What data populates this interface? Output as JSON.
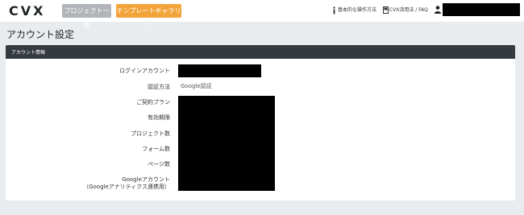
{
  "header": {
    "logo_text": "CVX",
    "project_list_button": "プロジェクト一覧",
    "template_gallery_button": "テンプレートギャラリー",
    "guide_link": "基本的な操作方法",
    "faq_link": "CVX活用法 / FAQ",
    "user_name": ""
  },
  "page": {
    "title": "アカウント設定"
  },
  "panel": {
    "header": "アカウント情報",
    "rows": [
      {
        "label": "ログインアカウント",
        "value": ""
      },
      {
        "label": "認証方法",
        "value": "Google認証"
      },
      {
        "label": "ご契約プラン",
        "value": ""
      },
      {
        "label": "有効期限",
        "value": ""
      },
      {
        "label": "プロジェクト数",
        "value": ""
      },
      {
        "label": "フォーム数",
        "value": ""
      },
      {
        "label": "ページ数",
        "value": ""
      },
      {
        "label": "Googleアカウント",
        "value": ""
      },
      {
        "label": "（Googleアナリティクス連携用）",
        "value": ""
      }
    ]
  },
  "colors": {
    "accent_orange": "#f2a43a",
    "button_gray": "#b1b5b9",
    "panel_header": "#343a40",
    "background": "#e9ecef"
  }
}
